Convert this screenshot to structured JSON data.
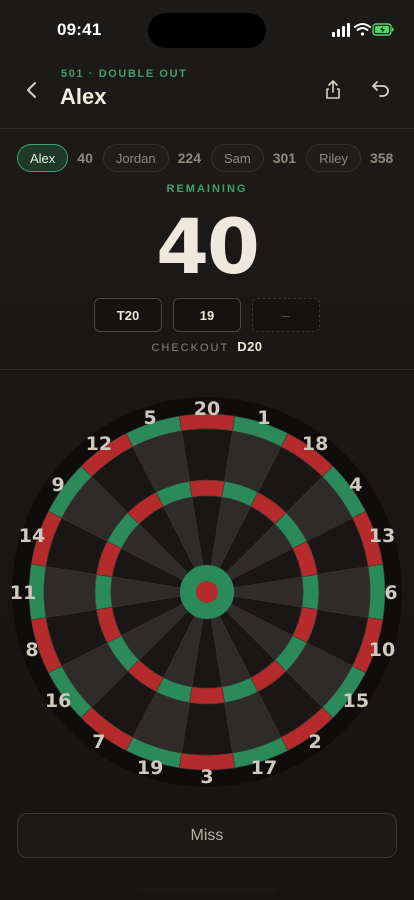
{
  "status_bar": {
    "time": "09:41"
  },
  "header": {
    "mode": "501 · DOUBLE OUT",
    "title": "Alex"
  },
  "players": [
    {
      "name": "Alex",
      "score": "40",
      "active": true
    },
    {
      "name": "Jordan",
      "score": "224",
      "active": false
    },
    {
      "name": "Sam",
      "score": "301",
      "active": false
    },
    {
      "name": "Riley",
      "score": "358",
      "active": false
    }
  ],
  "remaining": {
    "label": "REMAINING",
    "value": "40"
  },
  "darts": [
    "T20",
    "19",
    "–"
  ],
  "checkout": {
    "label": "CHECKOUT",
    "value": "D20"
  },
  "board": {
    "numbers": [
      "20",
      "1",
      "18",
      "4",
      "13",
      "6",
      "10",
      "15",
      "2",
      "17",
      "3",
      "19",
      "7",
      "16",
      "8",
      "11",
      "14",
      "9",
      "12",
      "5"
    ],
    "colors": {
      "red": "#b52a2a",
      "green": "#2a8a5a",
      "dark": "#1a1614",
      "light": "#2e2b28",
      "bull": "#b52a2a",
      "outer_bull": "#2a8a5a"
    }
  },
  "miss_button": {
    "label": "Miss"
  },
  "accent_color": "#3fa06e"
}
